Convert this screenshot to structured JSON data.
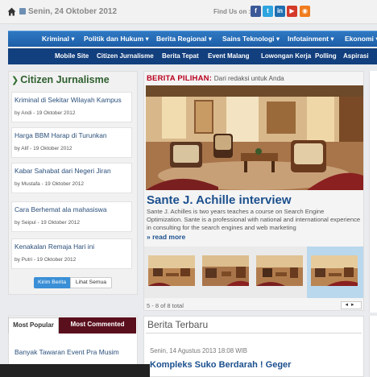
{
  "topbar": {
    "date": "Senin, 24 Oktober 2012",
    "find_us": "Find Us on :",
    "social": [
      {
        "name": "facebook-icon",
        "glyph": "f",
        "color": "#3b5998"
      },
      {
        "name": "twitter-icon",
        "glyph": "t",
        "color": "#2ea5e0"
      },
      {
        "name": "linkedin-icon",
        "glyph": "in",
        "color": "#1f6fb2"
      },
      {
        "name": "youtube-icon",
        "glyph": "▶",
        "color": "#d43a2a"
      },
      {
        "name": "rss-icon",
        "glyph": "◉",
        "color": "#f07c1e"
      }
    ]
  },
  "nav_main": [
    {
      "label": "Kriminal ▾"
    },
    {
      "label": "Politik dan Hukum ▾"
    },
    {
      "label": "Berita Regional ▾"
    },
    {
      "label": "Sains Teknologi ▾"
    },
    {
      "label": "Infotainment ▾"
    },
    {
      "label": "Ekonomi ▾"
    }
  ],
  "nav_sub": [
    {
      "label": "Mobile Site"
    },
    {
      "label": "Citizen Jurnalisme"
    },
    {
      "label": "Berita Tepat"
    },
    {
      "label": "Event Malang"
    },
    {
      "label": "Lowongan Kerja"
    },
    {
      "label": "Polling"
    },
    {
      "label": "Aspirasi"
    }
  ],
  "citizen": {
    "title": "Citizen Jurnalisme",
    "items": [
      {
        "title": "Kriminal di Sekitar Wilayah Kampus",
        "meta": "by Andi - 19 Oktober 2012"
      },
      {
        "title": "Harga BBM Harap di Turunkan",
        "meta": "by Alif - 19 Oktober 2012"
      },
      {
        "title": "Kabar Sahabat dari Negeri Jiran",
        "meta": "by Mustafa - 19 Oktober 2012"
      },
      {
        "title": "Cara Berhemat ala mahasiswa",
        "meta": "by Seipul - 19 Oktober 2012"
      },
      {
        "title": "Kenakalan Remaja Hari ini",
        "meta": "by Putri - 19 Oktober 2012"
      }
    ],
    "btn_send": "Kirim Berita",
    "btn_all": "Lihat Semua"
  },
  "tabs": {
    "most_popular": "Most Popular",
    "most_commented": "Most Commented",
    "first_item": "Banyak Tawaran Event Pra Musim"
  },
  "featured": {
    "label": "BERITA PILIHAN:",
    "subtitle": "Dari redaksi untuk Anda",
    "title": "Sante J. Achille interview",
    "description": "Sante J. Achilles is two years teaches a course on Search Engine Optimization. Sante is a professional with national and international experience in consulting for the search engines and web marketing",
    "read_more": "» read more",
    "counter": "5 - 8 of 8 total",
    "arrows": "◂▸"
  },
  "latest": {
    "title": "Berita Terbaru",
    "date": "Senin, 14 Agustus 2013 18:08 WIB",
    "headline": "Kompleks Suko Berdarah ! Geger"
  }
}
